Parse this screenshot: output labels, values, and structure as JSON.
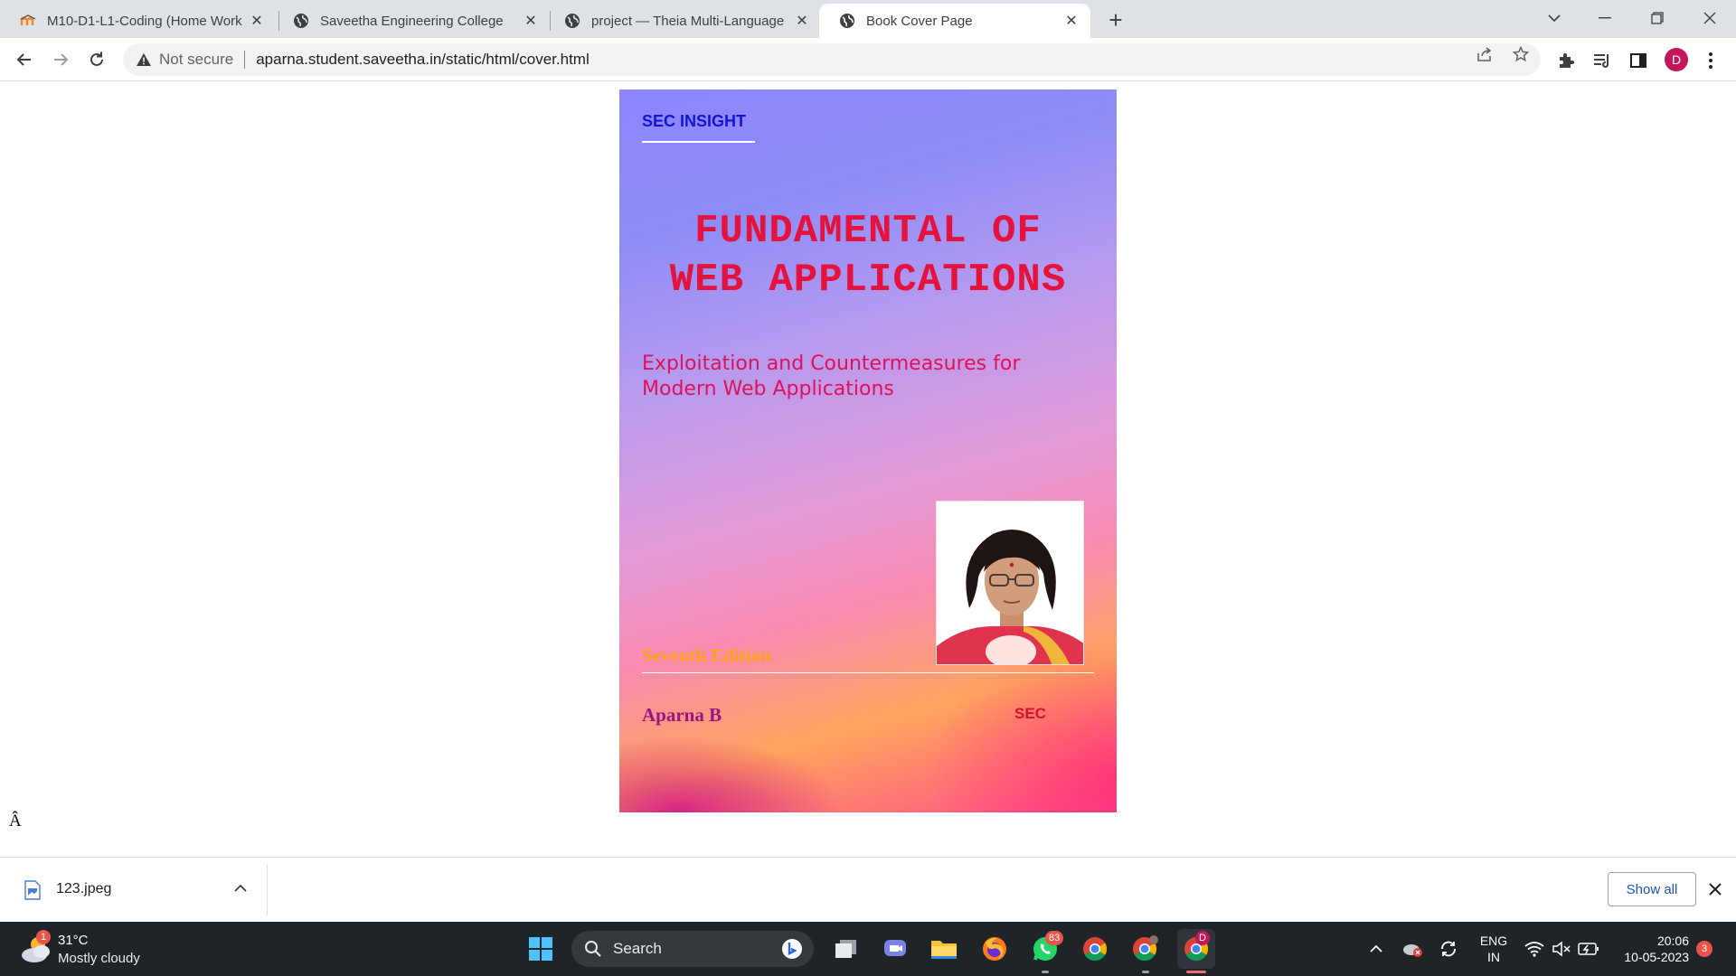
{
  "browser": {
    "tabs": [
      {
        "title": "M10-D1-L1-Coding (Home Work",
        "active": false
      },
      {
        "title": "Saveetha Engineering College",
        "active": false
      },
      {
        "title": "project — Theia Multi-Language",
        "active": false
      },
      {
        "title": "Book Cover Page",
        "active": true
      }
    ],
    "close_glyph": "✕",
    "new_tab_glyph": "+",
    "window_controls": {
      "tab_search": "⌄",
      "minimize": "—",
      "restore": "❐",
      "close": "✕"
    },
    "omnibox": {
      "security_label": "Not secure",
      "url": "aparna.student.saveetha.in/static/html/cover.html"
    },
    "profile_initial": "D"
  },
  "cover": {
    "brand": "SEC INSIGHT",
    "title_line1": "FUNDAMENTAL OF",
    "title_line2": "WEB APPLICATIONS",
    "subtitle": "Exploitation and Countermeasures for Modern Web Applications",
    "edition": "Seventh Edition",
    "author": "Aparna B",
    "publisher": "SEC"
  },
  "page_stray_text": "Â",
  "download_shelf": {
    "file_name": "123.jpeg",
    "show_all_label": "Show all",
    "close_glyph": "✕"
  },
  "taskbar": {
    "weather": {
      "temperature": "31°C",
      "description": "Mostly cloudy",
      "badge": "1"
    },
    "search_label": "Search",
    "whatsapp_badge": "83",
    "chrome_profile_badge": "D",
    "language": {
      "line1": "ENG",
      "line2": "IN"
    },
    "clock": {
      "time": "20:06",
      "date": "10-05-2023"
    },
    "notification_count": "3"
  },
  "colors": {
    "cover_title": "#e4123d",
    "cover_brand": "#1414d4",
    "cover_subtitle": "#e0115a",
    "cover_edition": "#ffa21a",
    "cover_author": "#9b1580",
    "profile_avatar": "#c2185b",
    "show_all_text": "#1a55b8"
  }
}
